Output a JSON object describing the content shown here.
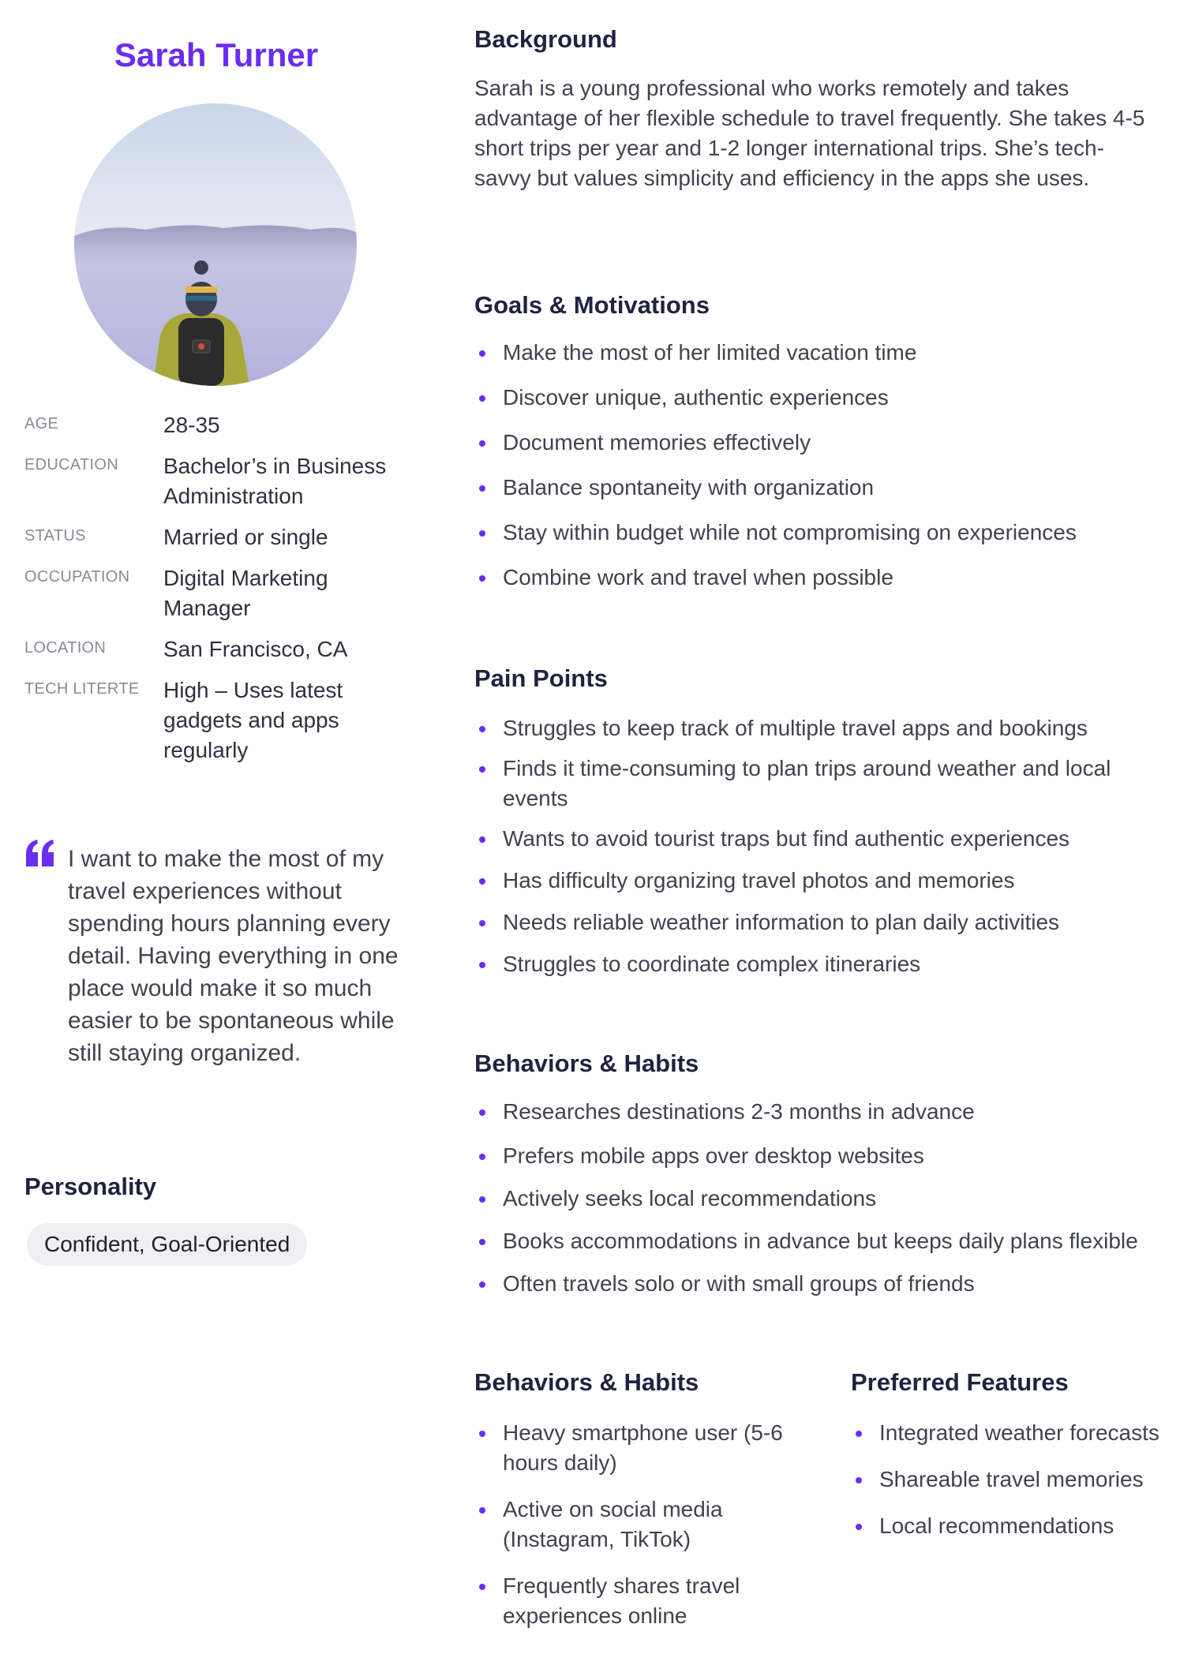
{
  "profile": {
    "name": "Sarah Turner",
    "facts": [
      {
        "label": "AGE",
        "value": "28-35"
      },
      {
        "label": "EDUCATION",
        "value": "Bachelor’s in Business Administration"
      },
      {
        "label": "STATUS",
        "value": "Married or single"
      },
      {
        "label": "OCCUPATION",
        "value": "Digital Marketing Manager"
      },
      {
        "label": "LOCATION",
        "value": "San Francisco, CA"
      },
      {
        "label": "TECH  LITERTE",
        "value": "High – Uses latest gadgets and apps regularly"
      }
    ],
    "quote": "I want to make the most of my travel experiences without spending hours planning every detail. Having everything in one place would make it so much easier to be spontaneous while still staying organized.",
    "personality_title": "Personality",
    "personality_chip": "Confident, Goal-Oriented"
  },
  "background": {
    "title": "Background",
    "text": "Sarah is a young professional who works remotely and takes advantage of her flexible schedule to travel frequently. She takes 4-5 short trips per year and 1-2 longer international trips. She’s tech-savvy but values simplicity and efficiency in the apps she uses."
  },
  "goals": {
    "title": "Goals & Motivations",
    "items": [
      "Make the most of her limited vacation time",
      "Discover unique, authentic experiences",
      "Document memories effectively",
      "Balance spontaneity with organization",
      "Stay within budget while not compromising on experiences",
      "Combine work and travel when possible"
    ]
  },
  "pain_points": {
    "title": "Pain Points",
    "items": [
      "Struggles to keep track of multiple travel apps and bookings",
      "Finds it time-consuming to plan trips around weather and local events",
      "Wants to avoid tourist traps but find authentic experiences",
      "Has difficulty organizing travel photos and memories",
      "Needs reliable weather information to plan daily activities",
      "Struggles to coordinate complex itineraries"
    ]
  },
  "behaviors": {
    "title": "Behaviors & Habits",
    "items": [
      "Researches destinations 2-3 months in advance",
      "Prefers mobile apps over desktop websites",
      "Actively seeks local recommendations",
      "Books accommodations in advance but keeps daily plans flexible",
      "Often travels solo or with small groups of friends"
    ]
  },
  "tech_habits": {
    "title": "Behaviors & Habits",
    "items": [
      "Heavy smartphone user (5-6 hours daily)",
      "Active on social media (Instagram, TikTok)",
      "Frequently shares travel experiences online"
    ]
  },
  "features": {
    "title": "Preferred Features",
    "items": [
      "Integrated weather forecasts",
      "Shareable travel memories",
      "Local recommendations"
    ]
  },
  "colors": {
    "accent": "#6a2df2",
    "heading": "#1f2340",
    "body": "#40424f",
    "muted": "#888b97",
    "chip_bg": "#f0f0f2"
  },
  "icons": {
    "quote": "quote-icon",
    "bullet": "bullet-dot-icon"
  }
}
